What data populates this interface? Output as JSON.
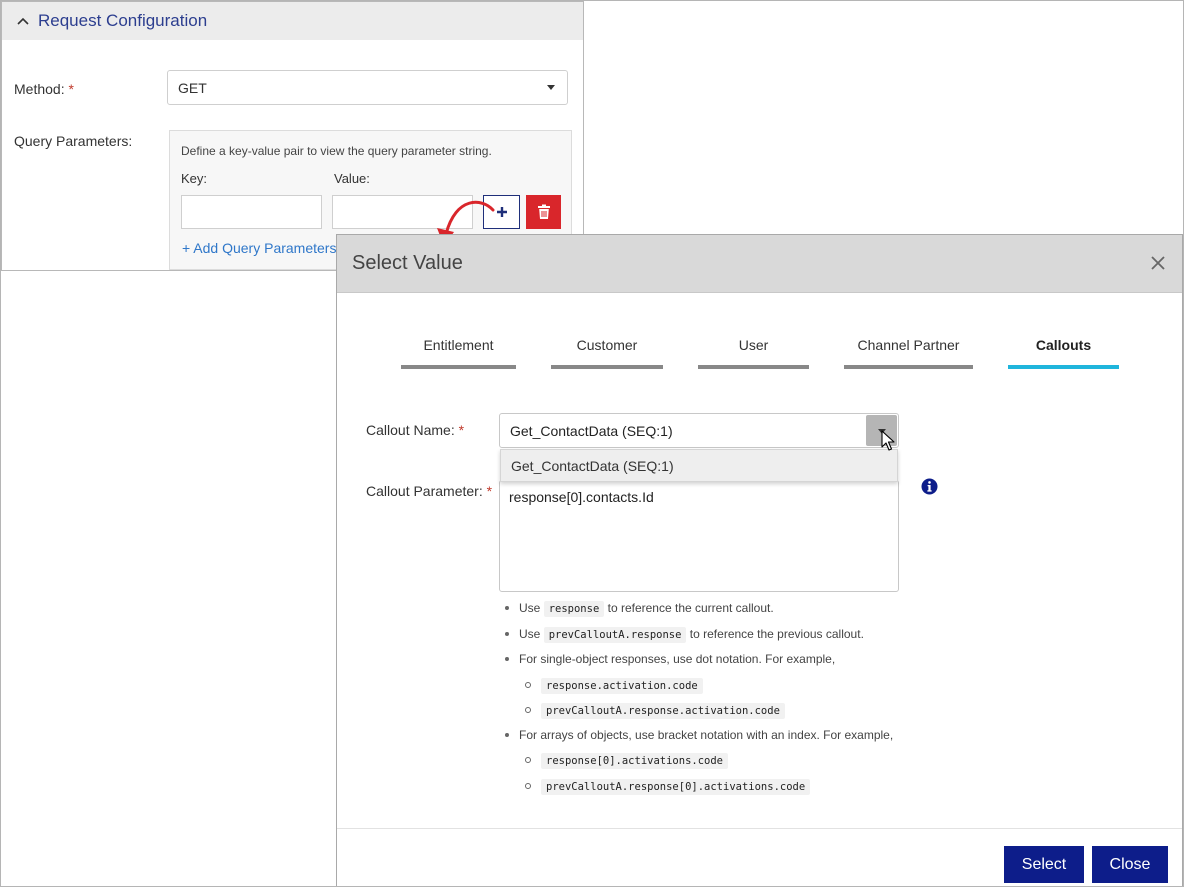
{
  "request_config": {
    "title": "Request Configuration",
    "method_label": "Method:",
    "required_mark": "*",
    "method_value": "GET",
    "query_params_label": "Query Parameters:",
    "query_hint": "Define a key-value pair to view the query parameter string.",
    "key_label": "Key:",
    "value_label": "Value:",
    "key_value": "",
    "value_value": "",
    "add_link": "+ Add Query Parameters"
  },
  "modal": {
    "title": "Select Value",
    "tabs": [
      {
        "label": "Entitlement",
        "active": false
      },
      {
        "label": "Customer",
        "active": false
      },
      {
        "label": "User",
        "active": false
      },
      {
        "label": "Channel Partner",
        "active": false
      },
      {
        "label": "Callouts",
        "active": true
      }
    ],
    "callout_name_label": "Callout Name:",
    "callout_name_value": "Get_ContactData (SEQ:1)",
    "dropdown_option": "Get_ContactData (SEQ:1)",
    "callout_param_label": "Callout Parameter:",
    "callout_param_value": "response[0].contacts.Id",
    "hints": {
      "h1_pre": "Use",
      "h1_code": "response",
      "h1_post": "to reference the current callout.",
      "h2_pre": "Use",
      "h2_code": "prevCalloutA.response",
      "h2_post": "to reference the previous callout.",
      "h3": "For single-object responses, use dot notation. For example,",
      "h3_ex1": "response.activation.code",
      "h3_ex2": "prevCalloutA.response.activation.code",
      "h4": "For arrays of objects, use bracket notation with an index. For example,",
      "h4_ex1": "response[0].activations.code",
      "h4_ex2": "prevCalloutA.response[0].activations.code"
    },
    "select_button": "Select",
    "close_button": "Close"
  },
  "colors": {
    "accent_tab": "#1fb5dc",
    "primary_button": "#0d1d8a",
    "delete_button": "#d9262b",
    "link": "#2f77c9",
    "arrow": "#d9262b"
  }
}
